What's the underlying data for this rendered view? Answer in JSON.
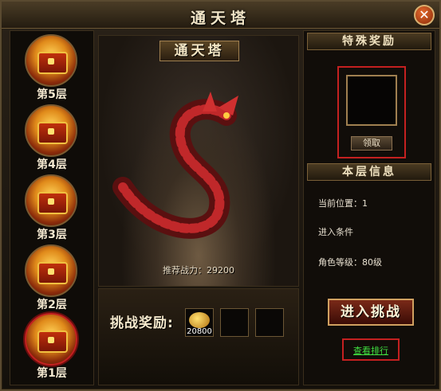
{
  "window": {
    "title": "通天塔",
    "close_glyph": "✕"
  },
  "floors": [
    {
      "label": "第5层"
    },
    {
      "label": "第4层"
    },
    {
      "label": "第3层"
    },
    {
      "label": "第2层"
    },
    {
      "label": "第1层",
      "selected": true
    }
  ],
  "scene": {
    "title": "通天塔",
    "recommended_power": "推荐战力：29200"
  },
  "rewards": {
    "label": "挑战奖励:",
    "slots": [
      {
        "icon": "gold-icon",
        "count": "20800"
      },
      {
        "icon": "",
        "count": ""
      },
      {
        "icon": "",
        "count": ""
      }
    ]
  },
  "right_panel": {
    "special_reward_header": "特殊奖励",
    "claim_label": "领取",
    "floor_info_header": "本层信息",
    "current_position": "当前位置：1",
    "entry_conditions": "进入条件",
    "role_level": "角色等级：80级",
    "enter_challenge": "进入挑战",
    "view_ranking": "查看排行"
  },
  "colors": {
    "accent_red": "#c42020",
    "link_green": "#40e040",
    "gold": "#d0a060"
  }
}
